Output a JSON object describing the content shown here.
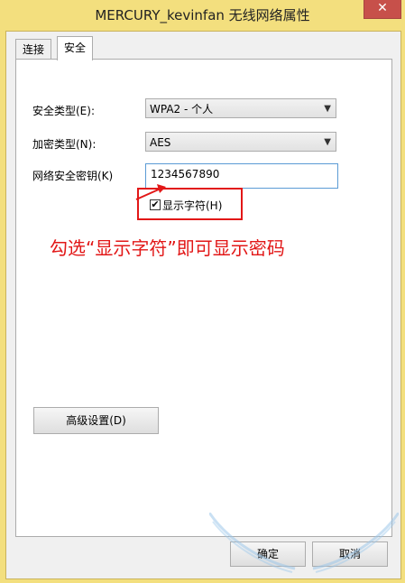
{
  "window": {
    "title": "MERCURY_kevinfan 无线网络属性",
    "close_label": "✕"
  },
  "tabs": [
    {
      "label": "连接"
    },
    {
      "label": "安全"
    }
  ],
  "security": {
    "type_label": "安全类型(E):",
    "type_value": "WPA2 - 个人",
    "encryption_label": "加密类型(N):",
    "encryption_value": "AES",
    "key_label": "网络安全密钥(K)",
    "key_value": "1234567890",
    "show_chars_label": "显示字符(H)",
    "show_chars_checked": "✔"
  },
  "annotation": "勾选“显示字符”即可显示密码",
  "buttons": {
    "advanced": "高级设置(D)",
    "ok": "确定",
    "cancel": "取消"
  },
  "colors": {
    "window_frame": "#f3df7e",
    "annotation_red": "#e21717"
  }
}
